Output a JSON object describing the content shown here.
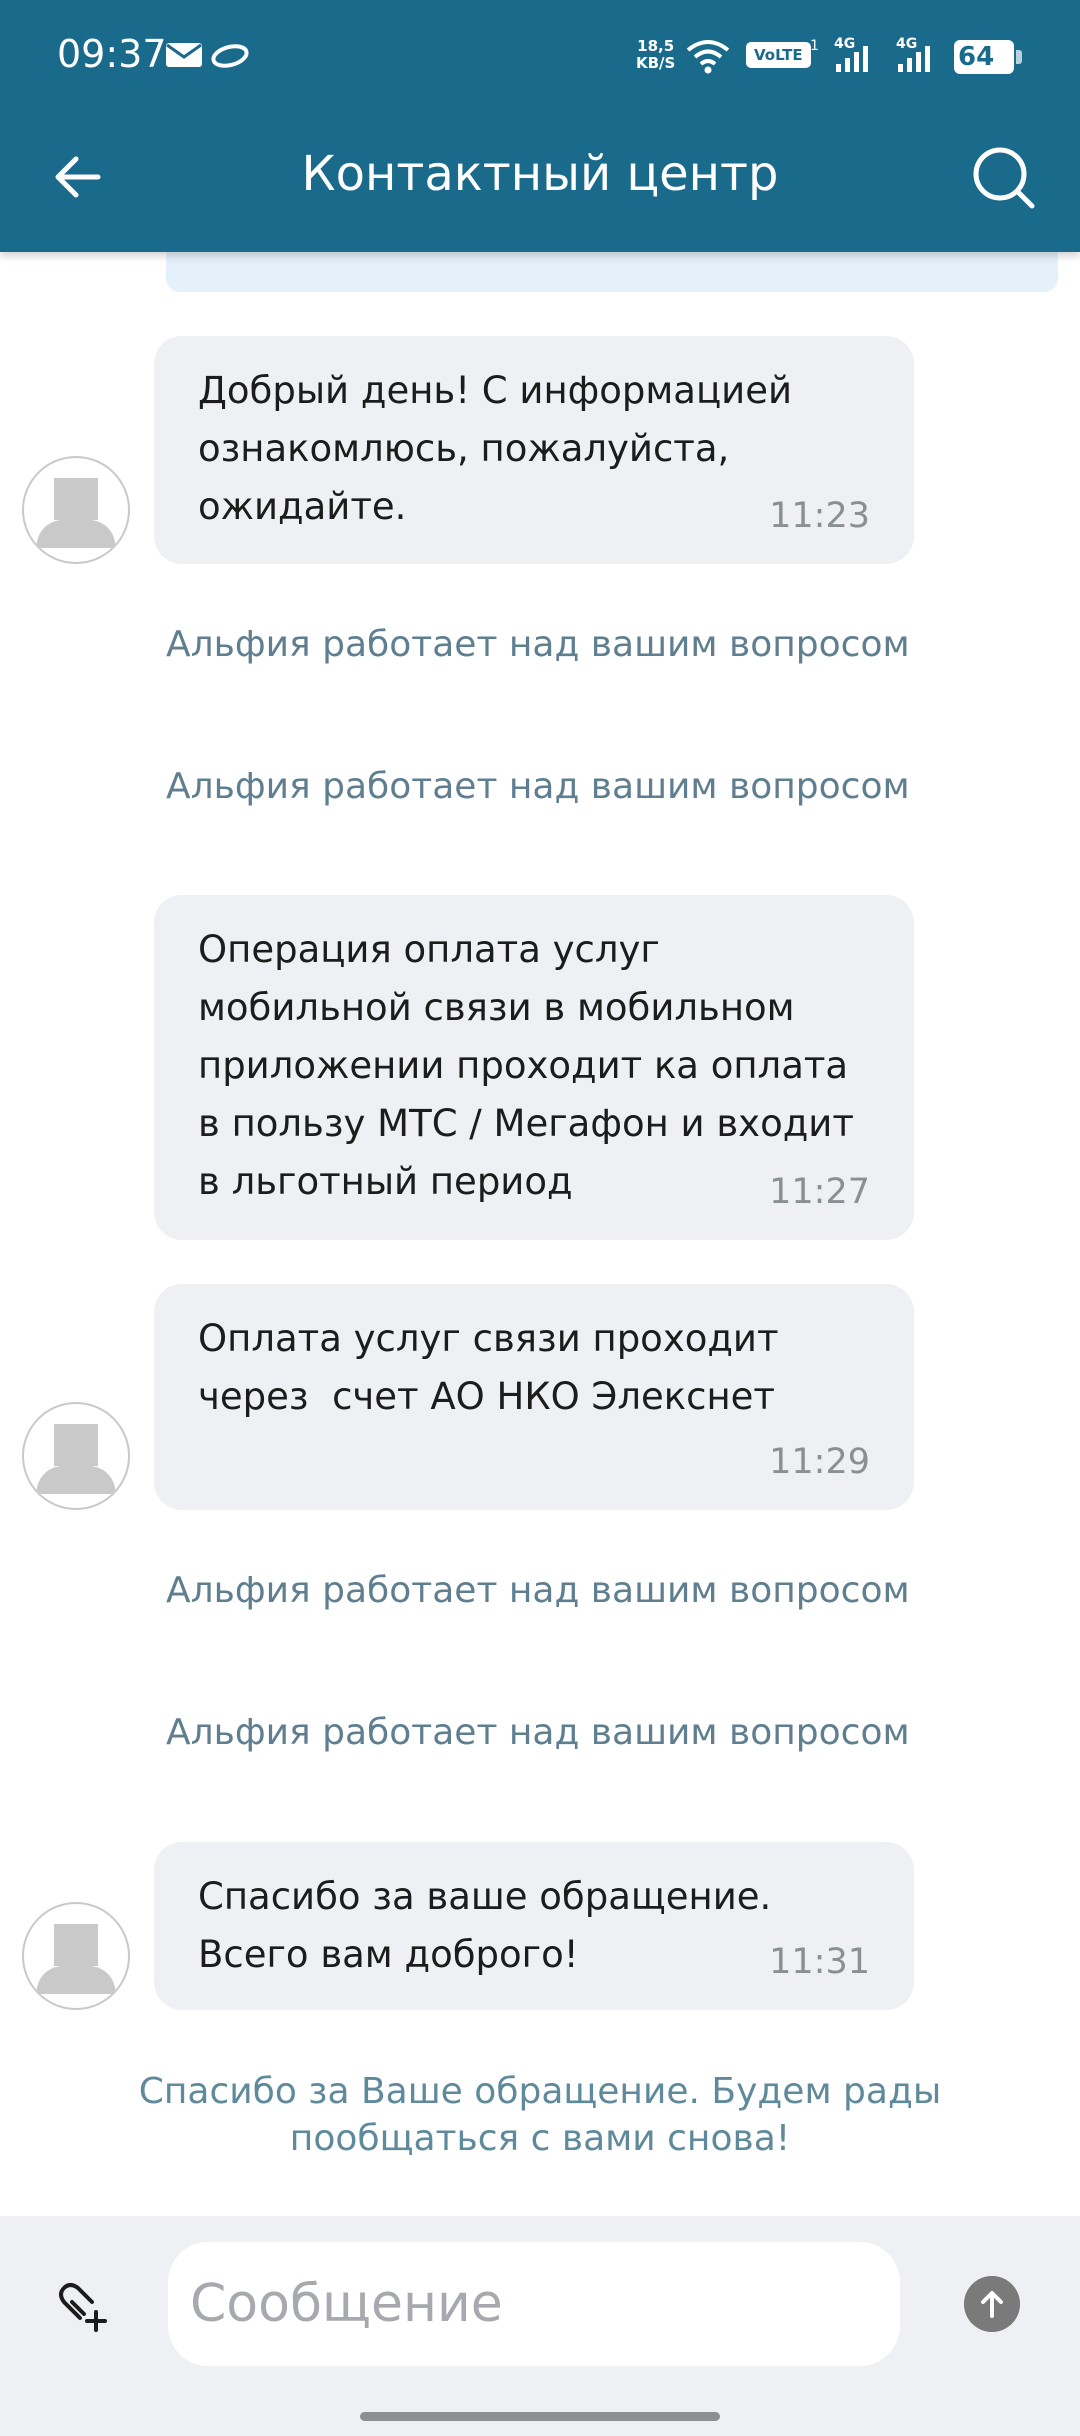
{
  "status_bar": {
    "time": "09:37",
    "net_speed_value": "18,5",
    "net_speed_unit": "KB/S",
    "volte": "VoLTE",
    "sim1_sup": "1",
    "sig1": "4G",
    "sig2": "4G",
    "battery": "64"
  },
  "header": {
    "title": "Контактный центр",
    "color": "#1a6a8c"
  },
  "chat": {
    "messages": [
      {
        "text": "Добрый день! С информацией\nознакомлюсь, пожалуйста,\nожидайте.",
        "time": "11:23"
      },
      {
        "text": "Операция оплата услуг\nмобильной связи в мобильном\nприложении проходит ка оплата\nв пользу МТС / Мегафон и входит\nв льготный период",
        "time": "11:27"
      },
      {
        "text": "Оплата услуг связи проходит\nчерез  счет АО НКО Элекснет",
        "time": "11:29"
      },
      {
        "text": "Спасибо за ваше обращение.\nВсего вам доброго!",
        "time": "11:31"
      }
    ],
    "system_notes": [
      "Альфия работает над вашим вопросом",
      "Альфия работает над вашим вопросом",
      "Альфия работает над вашим вопросом",
      "Альфия работает над вашим вопросом"
    ],
    "closing_message": "Спасибо за Ваше обращение. Будем рады пообщаться с вами снова!"
  },
  "composer": {
    "placeholder": "Сообщение",
    "value": ""
  },
  "icons": {
    "back": "arrow-left-icon",
    "search": "search-icon",
    "attach": "attach-add-icon",
    "send": "arrow-up-icon",
    "avatar": "user-avatar-icon"
  }
}
